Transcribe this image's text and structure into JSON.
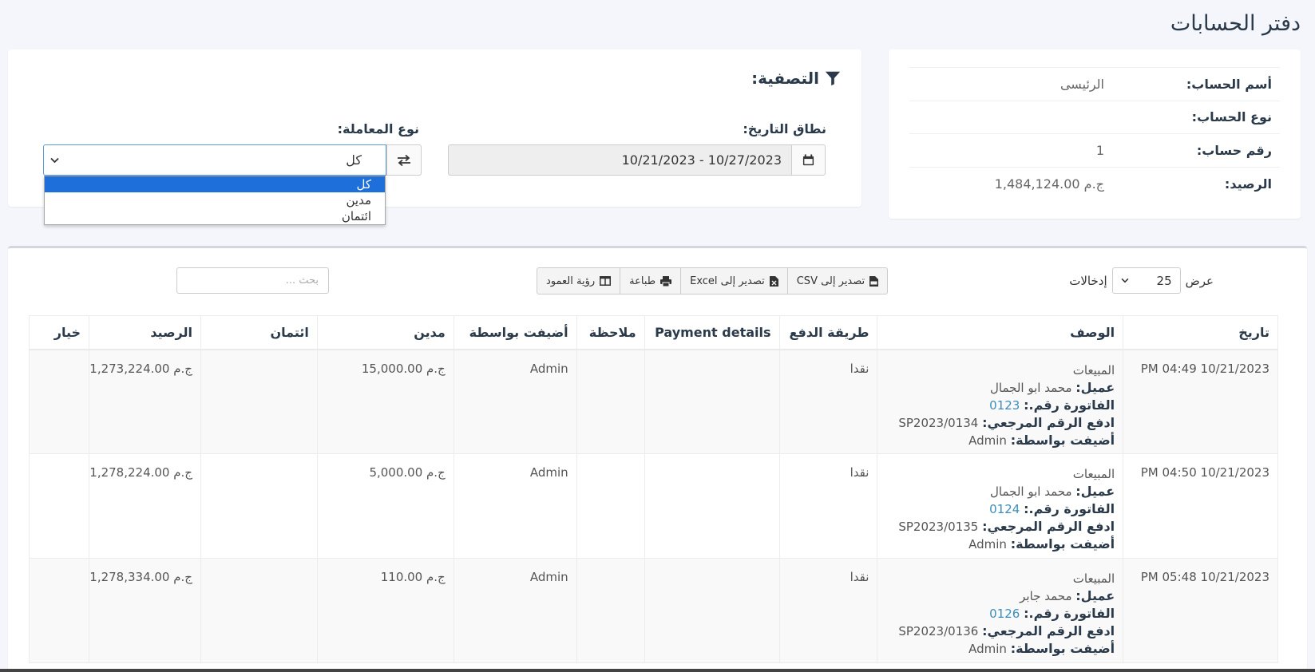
{
  "page": {
    "title": "دفتر الحسابات"
  },
  "account": {
    "rows": [
      {
        "label": "أسم الحساب:",
        "value": "الرئيسى"
      },
      {
        "label": "نوع الحساب:",
        "value": ""
      },
      {
        "label": "رقم حساب:",
        "value": "1"
      },
      {
        "label": "الرصيد:",
        "value": "ج.م 1,484,124.00"
      }
    ]
  },
  "filter": {
    "title": "التصفية:",
    "date_label": "نطاق التاريخ:",
    "date_value": "10/27/2023 - 10/21/2023",
    "type_label": "نوع المعاملة:",
    "type_selected": "كل",
    "options": [
      "كل",
      "مدين",
      "ائتمان"
    ]
  },
  "toolbar": {
    "show_label": "عرض",
    "entries_value": "25",
    "entries_label": "إدخالات",
    "export_csv": "تصدير إلى CSV",
    "export_excel": "تصدير إلى Excel",
    "print": "طباعة",
    "column_visibility": "رؤية العمود",
    "search_placeholder": "بحث ..."
  },
  "table": {
    "headers": [
      "تاريخ",
      "الوصف",
      "طريقة الدفع",
      "Payment details",
      "ملاحظة",
      "أضيفت بواسطة",
      "مدين",
      "ائتمان",
      "الرصيد",
      "خيار"
    ],
    "desc_labels": {
      "customer": "عميل:",
      "invoice": "الفاتورة رقم.:",
      "ref": "ادفع الرقم المرجعي:",
      "added_by": "أضيفت بواسطة:"
    },
    "rows": [
      {
        "date": "10/21/2023 04:49 PM",
        "type": "المبيعات",
        "customer": "محمد ابو الجمال",
        "invoice": "0123",
        "ref": "SP2023/0134",
        "added_by_desc": "Admin",
        "method": "نقدا",
        "details": "",
        "note": "",
        "added_by": "Admin",
        "debit": "ج.م 15,000.00",
        "credit": "",
        "balance": "ج.م 1,273,224.00"
      },
      {
        "date": "10/21/2023 04:50 PM",
        "type": "المبيعات",
        "customer": "محمد ابو الجمال",
        "invoice": "0124",
        "ref": "SP2023/0135",
        "added_by_desc": "Admin",
        "method": "نقدا",
        "details": "",
        "note": "",
        "added_by": "Admin",
        "debit": "ج.م 5,000.00",
        "credit": "",
        "balance": "ج.م 1,278,224.00"
      },
      {
        "date": "10/21/2023 05:48 PM",
        "type": "المبيعات",
        "customer": "محمد جابر",
        "invoice": "0126",
        "ref": "SP2023/0136",
        "added_by_desc": "Admin",
        "method": "نقدا",
        "details": "",
        "note": "",
        "added_by": "Admin",
        "debit": "ج.م 110.00",
        "credit": "",
        "balance": "ج.م 1,278,334.00"
      }
    ]
  },
  "colors": {
    "primary": "#1e6fd9",
    "link": "#3c8dbc",
    "title": "#2b3a4a"
  }
}
